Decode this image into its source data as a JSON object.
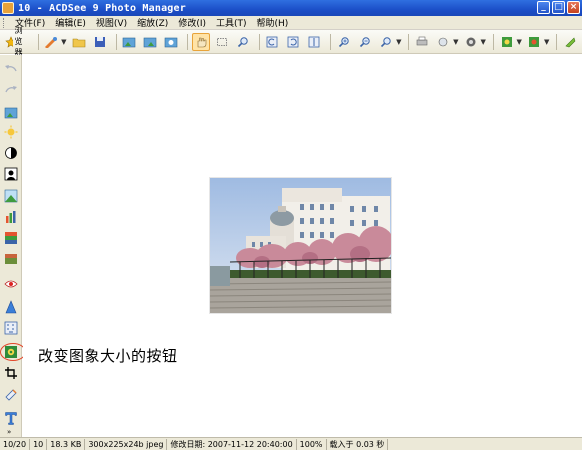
{
  "window": {
    "title": "10 - ACDSee 9 Photo Manager",
    "buttons": {
      "minimize": "_",
      "maximize": "□",
      "close": "×"
    }
  },
  "menu": [
    "文件(F)",
    "编辑(E)",
    "视图(V)",
    "缩放(Z)",
    "修改(I)",
    "工具(T)",
    "帮助(H)"
  ],
  "toolbar": {
    "browser_label": "浏览器",
    "icons": [
      "browser-icon",
      "edit-icon",
      "open-folder-icon",
      "save-icon",
      "prev-image-icon",
      "next-image-icon",
      "auto-advance-icon",
      "hand-icon",
      "select-icon",
      "zoom-icon",
      "rotate-left-icon",
      "rotate-right-icon",
      "flip-icon",
      "zoom-in-icon",
      "zoom-out-icon",
      "zoom-dropdown-icon",
      "print-icon",
      "email-icon",
      "rating-icon",
      "full-screen-icon",
      "slideshow-icon",
      "plugins-icon"
    ]
  },
  "rail": {
    "icons": [
      "undo-icon",
      "redo-icon",
      "image-info-icon",
      "exposure-icon",
      "levels-icon",
      "curves-icon",
      "lighting-icon",
      "color-balance-icon",
      "histogram-icon",
      "adjust-icon",
      "red-eye-icon",
      "sharpen-icon",
      "noise-icon",
      "resize-icon",
      "crop-icon",
      "rotate-icon",
      "text-icon"
    ]
  },
  "viewer": {
    "annotation": "改变图象大小的按钮"
  },
  "status": {
    "position": "10/20",
    "index": "10",
    "filesize": "18.3 KB",
    "dimensions": "300x225x24b jpeg",
    "modified": "修改日期: 2007-11-12 20:40:00",
    "zoom": "100%",
    "load_time": "载入于 0.03 秒"
  },
  "colors": {
    "title_bar": "#1c4fc8",
    "chrome": "#ece9d8",
    "highlight_ring": "#e2472a"
  }
}
